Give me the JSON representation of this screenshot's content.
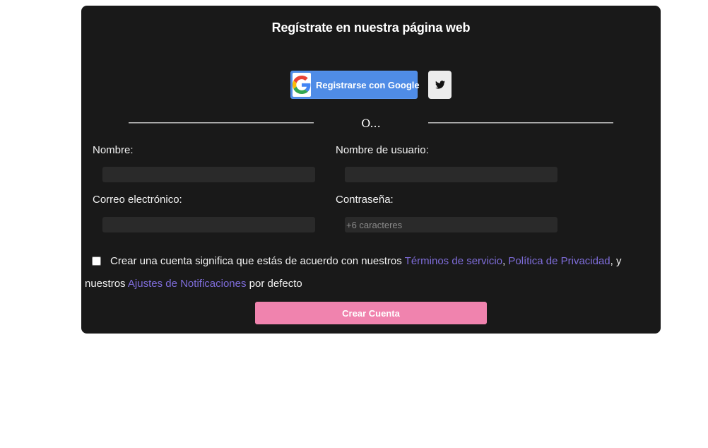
{
  "form": {
    "title": "Regístrate en nuestra página web",
    "google_button_label": "Registrarse con Google",
    "separator_text": "O...",
    "fields": {
      "name": {
        "label": "Nombre:",
        "value": "",
        "placeholder": ""
      },
      "username": {
        "label": "Nombre de usuario:",
        "value": "",
        "placeholder": ""
      },
      "email": {
        "label": "Correo electrónico:",
        "value": "",
        "placeholder": ""
      },
      "password": {
        "label": "Contraseña:",
        "value": "",
        "placeholder": "+6 caracteres"
      }
    },
    "terms": {
      "checked": false,
      "text_before": "Crear una cuenta significa que estás de acuerdo con nuestros",
      "link_terms": "Términos de servicio",
      "comma": ",",
      "link_privacy": "Política de Privacidad",
      "text_middle": ", y nuestros",
      "link_notifications": "Ajustes de Notificaciones",
      "text_after": "por defecto"
    },
    "submit_label": "Crear Cuenta"
  },
  "icons": {
    "google": "google-logo-icon",
    "twitter": "twitter-bird-icon"
  },
  "colors": {
    "card_background": "#191919",
    "google_blue": "#4f8ce6",
    "link_purple": "#7f6ddb",
    "submit_pink": "#f083ae"
  }
}
